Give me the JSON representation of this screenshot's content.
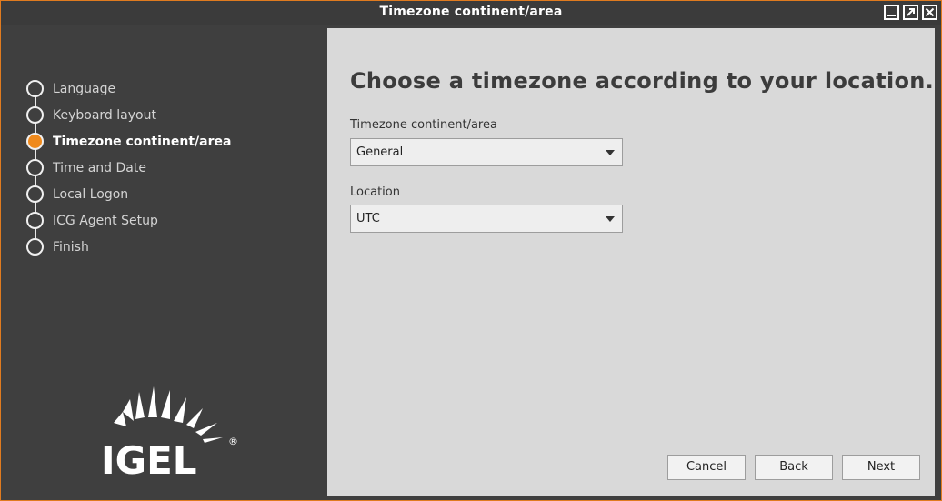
{
  "window": {
    "title": "Timezone continent/area"
  },
  "sidebar": {
    "steps": [
      {
        "label": "Language",
        "active": false
      },
      {
        "label": "Keyboard layout",
        "active": false
      },
      {
        "label": "Timezone continent/area",
        "active": true
      },
      {
        "label": "Time and Date",
        "active": false
      },
      {
        "label": "Local Logon",
        "active": false
      },
      {
        "label": "ICG Agent Setup",
        "active": false
      },
      {
        "label": "Finish",
        "active": false
      }
    ],
    "logo_text": "IGEL",
    "logo_mark": "®"
  },
  "main": {
    "heading": "Choose a timezone according to your location.",
    "continent_label": "Timezone continent/area",
    "continent_value": "General",
    "location_label": "Location",
    "location_value": "UTC"
  },
  "buttons": {
    "cancel": "Cancel",
    "back": "Back",
    "next": "Next"
  },
  "colors": {
    "accent": "#f08a1c",
    "sidebar_bg": "#3f3f3f",
    "panel_bg": "#d9d9d9"
  }
}
